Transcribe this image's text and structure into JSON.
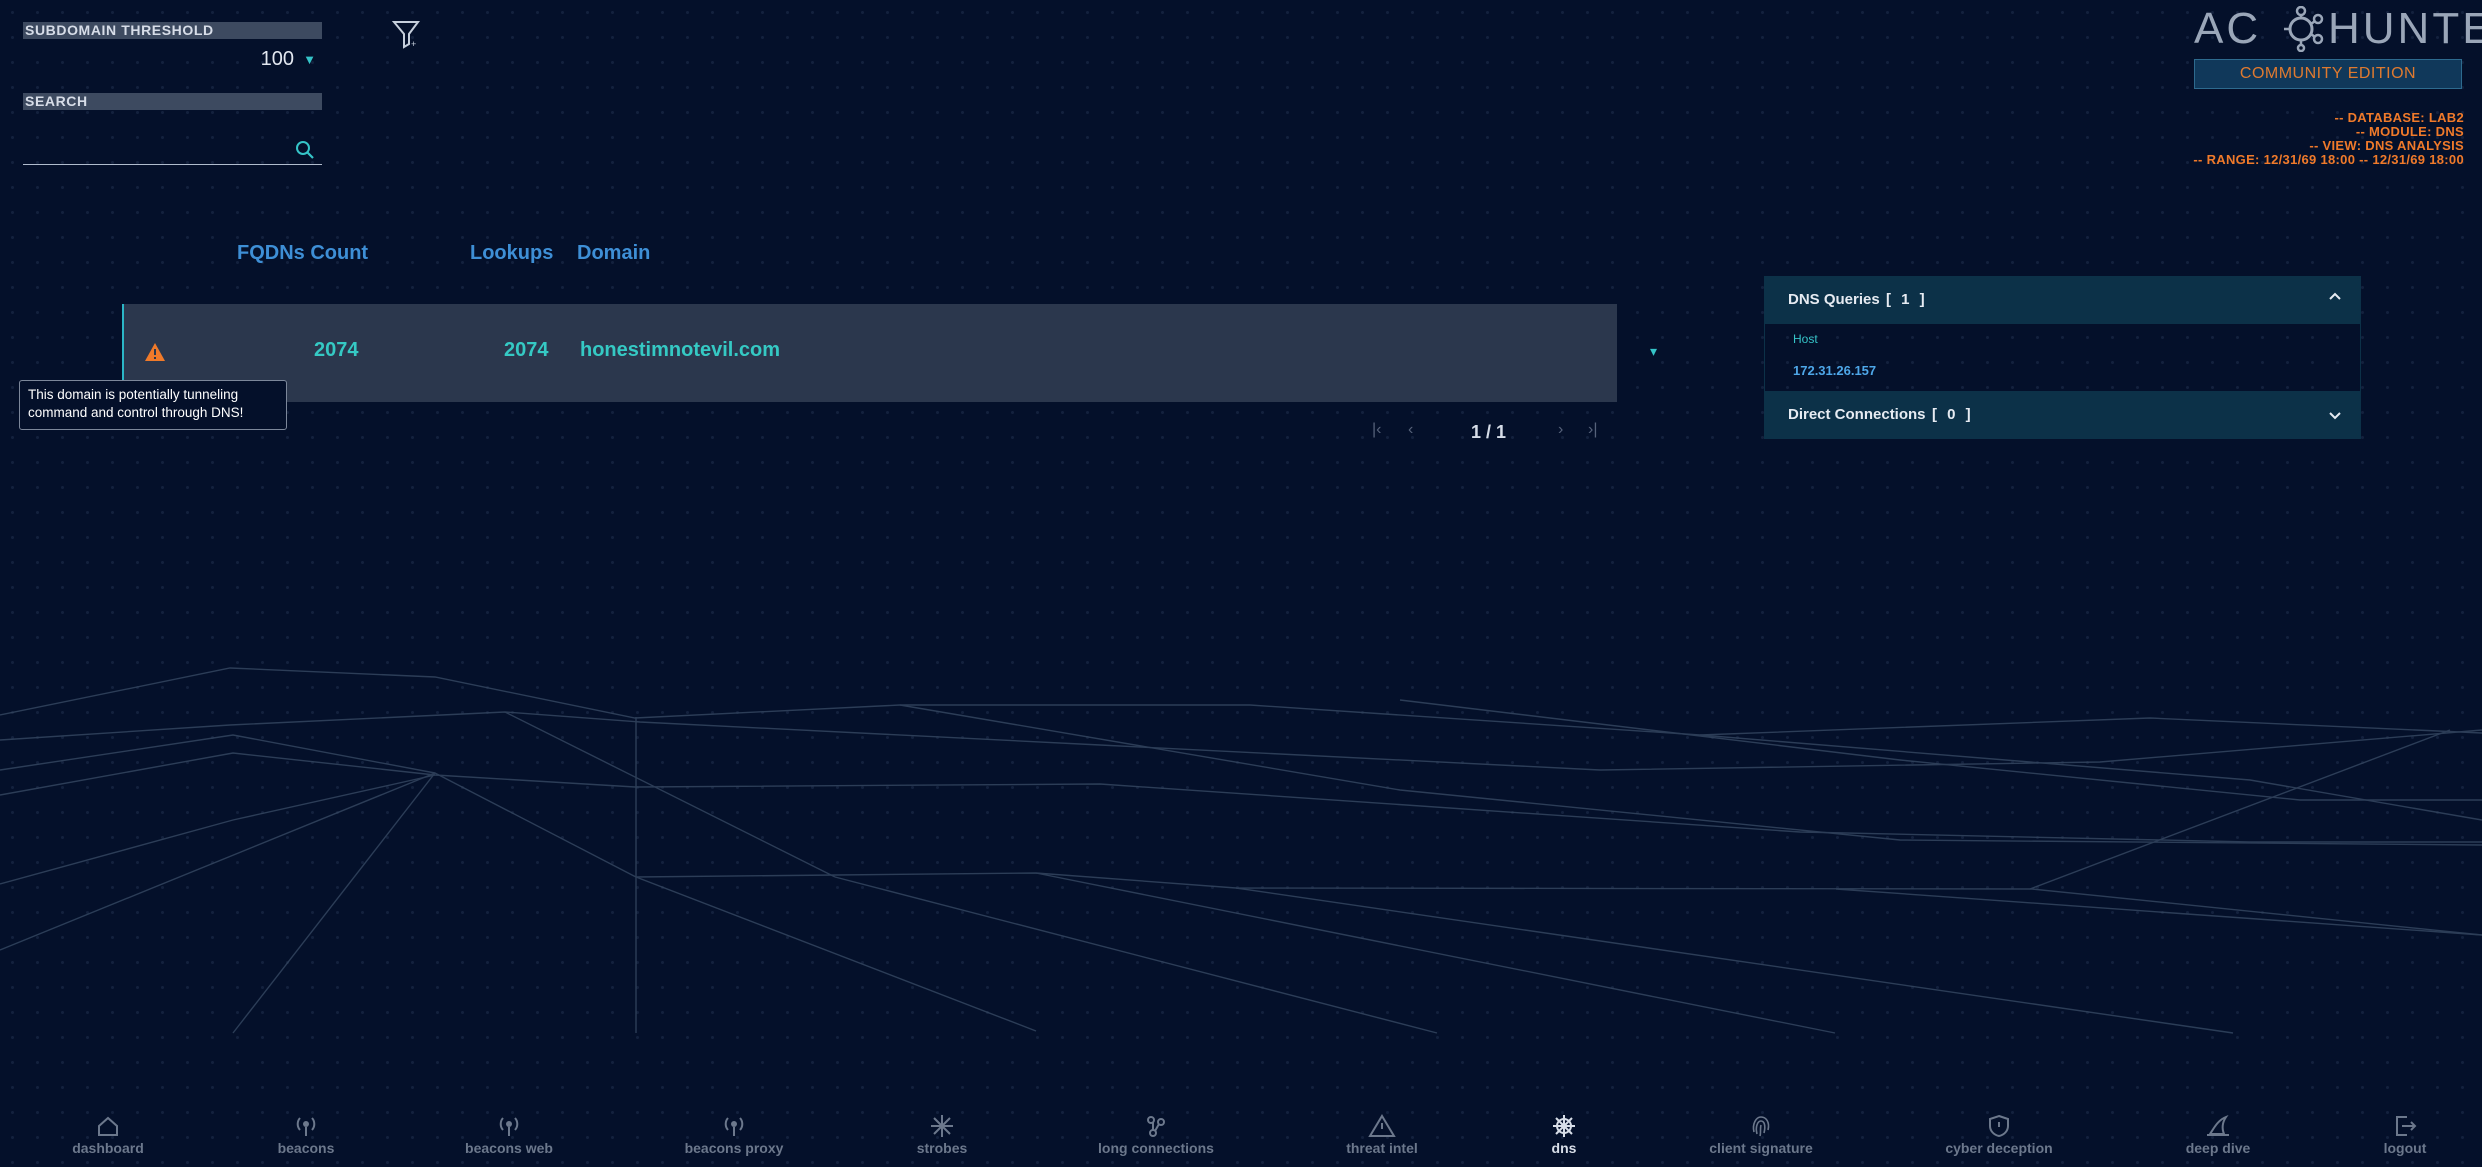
{
  "controls": {
    "subdomain_label": "SUBDOMAIN THRESHOLD",
    "threshold_value": "100",
    "search_label": "SEARCH",
    "search_placeholder": ""
  },
  "logo": {
    "left": "AC",
    "right": "HUNTER",
    "edition": "COMMUNITY EDITION"
  },
  "meta": {
    "database": "-- DATABASE: LAB2",
    "module": "-- MODULE: DNS",
    "view": "-- VIEW: DNS ANALYSIS",
    "range": "-- RANGE: 12/31/69 18:00 -- 12/31/69 18:00"
  },
  "table": {
    "headers": {
      "fqdn": "FQDNs Count",
      "lookups": "Lookups",
      "domain": "Domain"
    },
    "rows": [
      {
        "fqdns": "2074",
        "lookups": "2074",
        "domain": "honestimnotevil.com",
        "warning": true
      }
    ],
    "tooltip_line1": "This domain is potentially tunneling",
    "tooltip_line2": "command and control through DNS!",
    "pager": "1 / 1"
  },
  "panels": {
    "dns_queries": {
      "title": "DNS Queries",
      "count": "[ 1 ]",
      "host_label": "Host",
      "host": "172.31.26.157"
    },
    "direct": {
      "title": "Direct Connections",
      "count": "[ 0 ]"
    }
  },
  "nav": [
    {
      "label": "dashboard",
      "icon": "home-icon"
    },
    {
      "label": "beacons",
      "icon": "broadcast-icon"
    },
    {
      "label": "beacons web",
      "icon": "broadcast-icon"
    },
    {
      "label": "beacons proxy",
      "icon": "broadcast-icon"
    },
    {
      "label": "strobes",
      "icon": "burst-icon"
    },
    {
      "label": "long connections",
      "icon": "nodes-icon"
    },
    {
      "label": "threat intel",
      "icon": "warning-icon"
    },
    {
      "label": "dns",
      "icon": "wheel-icon"
    },
    {
      "label": "client signature",
      "icon": "fingerprint-icon"
    },
    {
      "label": "cyber deception",
      "icon": "shield-icon"
    },
    {
      "label": "deep dive",
      "icon": "fin-icon"
    },
    {
      "label": "logout",
      "icon": "logout-icon"
    }
  ],
  "colors": {
    "background": "#04102a",
    "accent_teal": "#35c9c4",
    "header_blue": "#3e8fd6",
    "meta_orange": "#f07a2a",
    "row_bg": "#2b374d",
    "panel_bg": "#0c3148"
  }
}
